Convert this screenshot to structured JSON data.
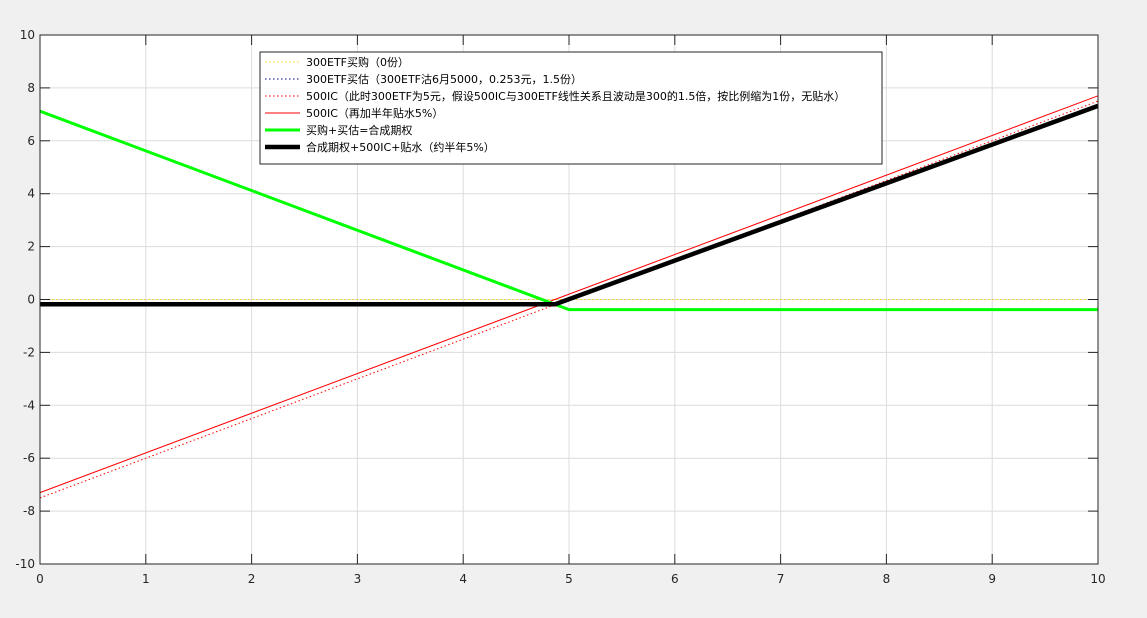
{
  "chart_data": {
    "type": "line",
    "title": "",
    "xlabel": "",
    "ylabel": "",
    "xlim": [
      0,
      10
    ],
    "ylim": [
      -10,
      10
    ],
    "xticks": [
      0,
      1,
      2,
      3,
      4,
      5,
      6,
      7,
      8,
      9,
      10
    ],
    "yticks": [
      -10,
      -8,
      -6,
      -4,
      -2,
      0,
      2,
      4,
      6,
      8,
      10
    ],
    "xtick_labels": [
      "0",
      "1",
      "2",
      "3",
      "4",
      "5",
      "6",
      "7",
      "8",
      "9",
      "10"
    ],
    "ytick_labels": [
      "-10",
      "-8",
      "-6",
      "-4",
      "-2",
      "0",
      "2",
      "4",
      "6",
      "8",
      "10"
    ],
    "grid": true,
    "legend_position": "top-center",
    "series": [
      {
        "name": "300ETF买购（0份）",
        "color": "#ffd700",
        "style": "dotted",
        "x": [
          0,
          10
        ],
        "y": [
          0,
          0
        ]
      },
      {
        "name": "300ETF买估（300ETF沽6月5000，0.253元，1.5份）",
        "color": "#000080",
        "style": "dotted",
        "x": [
          0,
          5,
          10
        ],
        "y": [
          7.12,
          -0.38,
          -0.38
        ]
      },
      {
        "name": "500IC（此时300ETF为5元，假设500IC与300ETF线性关系且波动是300的1.5倍，按比例缩为1份，无贴水）",
        "color": "#ff0000",
        "style": "dotted",
        "x": [
          0,
          10
        ],
        "y": [
          -7.5,
          7.5
        ]
      },
      {
        "name": "500IC（再加半年贴水5%）",
        "color": "#ff0000",
        "style": "solid",
        "x": [
          0,
          10
        ],
        "y": [
          -7.3,
          7.7
        ]
      },
      {
        "name": "买购+买估=合成期权",
        "color": "#00ff00",
        "style": "solid-thick",
        "x": [
          0,
          5,
          10
        ],
        "y": [
          7.12,
          -0.38,
          -0.38
        ]
      },
      {
        "name": "合成期权+500IC+贴水（约半年5%）",
        "color": "#000000",
        "style": "solid-heavy",
        "x": [
          0,
          4.87,
          10
        ],
        "y": [
          -0.18,
          -0.18,
          7.32
        ]
      }
    ]
  }
}
